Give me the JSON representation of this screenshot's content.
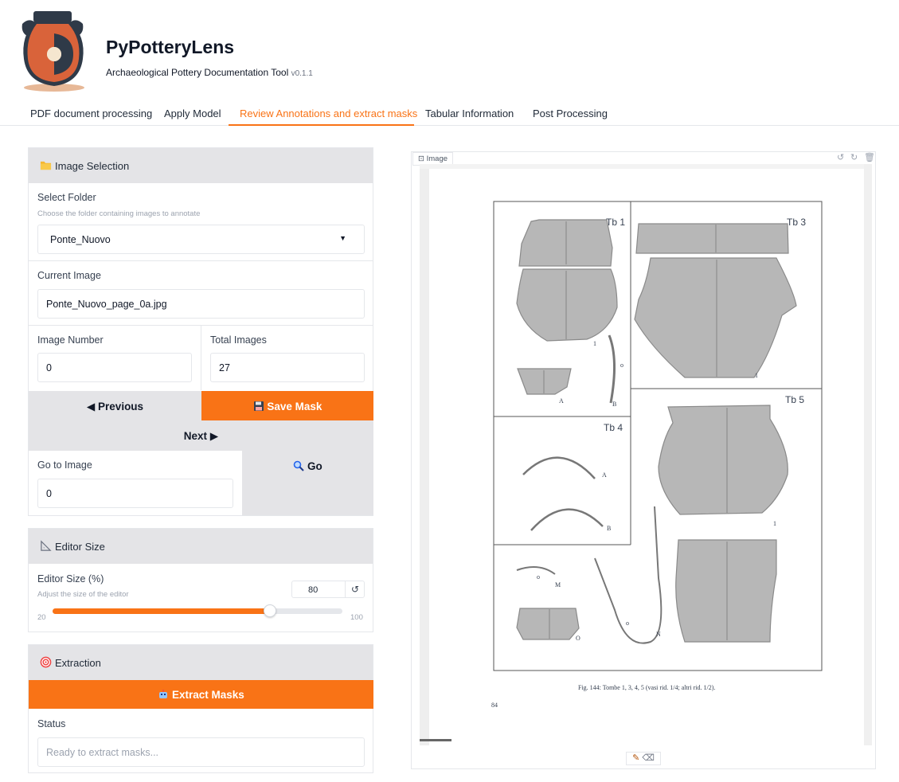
{
  "app": {
    "title": "PyPotteryLens",
    "subtitle": "Archaeological Pottery Documentation Tool",
    "version": "v0.1.1"
  },
  "tabs": [
    {
      "label": "PDF document processing"
    },
    {
      "label": "Apply Model"
    },
    {
      "label": "Review Annotations and extract masks",
      "active": true
    },
    {
      "label": "Tabular Information"
    },
    {
      "label": "Post Processing"
    }
  ],
  "image_selection": {
    "title": "Image Selection",
    "select_folder_label": "Select Folder",
    "select_folder_hint": "Choose the folder containing images to annotate",
    "folder_value": "Ponte_Nuovo",
    "current_image_label": "Current Image",
    "current_image_value": "Ponte_Nuovo_page_0a.jpg",
    "image_number_label": "Image Number",
    "image_number_value": "0",
    "total_images_label": "Total Images",
    "total_images_value": "27",
    "previous_label": "◀ Previous",
    "save_mask_label": "Save Mask",
    "next_label": "Next ▶",
    "go_to_image_label": "Go to Image",
    "go_to_image_value": "0",
    "go_label": "Go"
  },
  "editor_size": {
    "title": "Editor Size",
    "label": "Editor Size (%)",
    "hint": "Adjust the size of the editor",
    "value": "80",
    "min": "20",
    "max": "100",
    "fraction": 0.75
  },
  "extraction": {
    "title": "Extraction",
    "extract_label": "Extract Masks",
    "status_label": "Status",
    "status_placeholder": "Ready to extract masks..."
  },
  "viewer": {
    "badge": "Image",
    "page": {
      "labels": {
        "tb1": "Tb 1",
        "tb3": "Tb 3",
        "tb4": "Tb 4",
        "tb5": "Tb 5",
        "one_a": "1",
        "o_a": "o",
        "a1": "A",
        "b1": "B",
        "one_b": "1",
        "a4": "A",
        "b4": "B",
        "one_c": "1",
        "m": "M",
        "o_b": "O",
        "n": "N",
        "o_c": "o",
        "o_d": "o"
      },
      "caption": "Fig. 144: Tombe 1, 3, 4, 5 (vasi rid. 1/4; altri rid. 1/2).",
      "page_number": "84"
    }
  },
  "colors": {
    "accent": "#f97316",
    "panel_header": "#e4e4e7",
    "mask_fill": "#b7b7b7",
    "logo_terracotta": "#d9633a",
    "logo_dark": "#2f3a48"
  }
}
